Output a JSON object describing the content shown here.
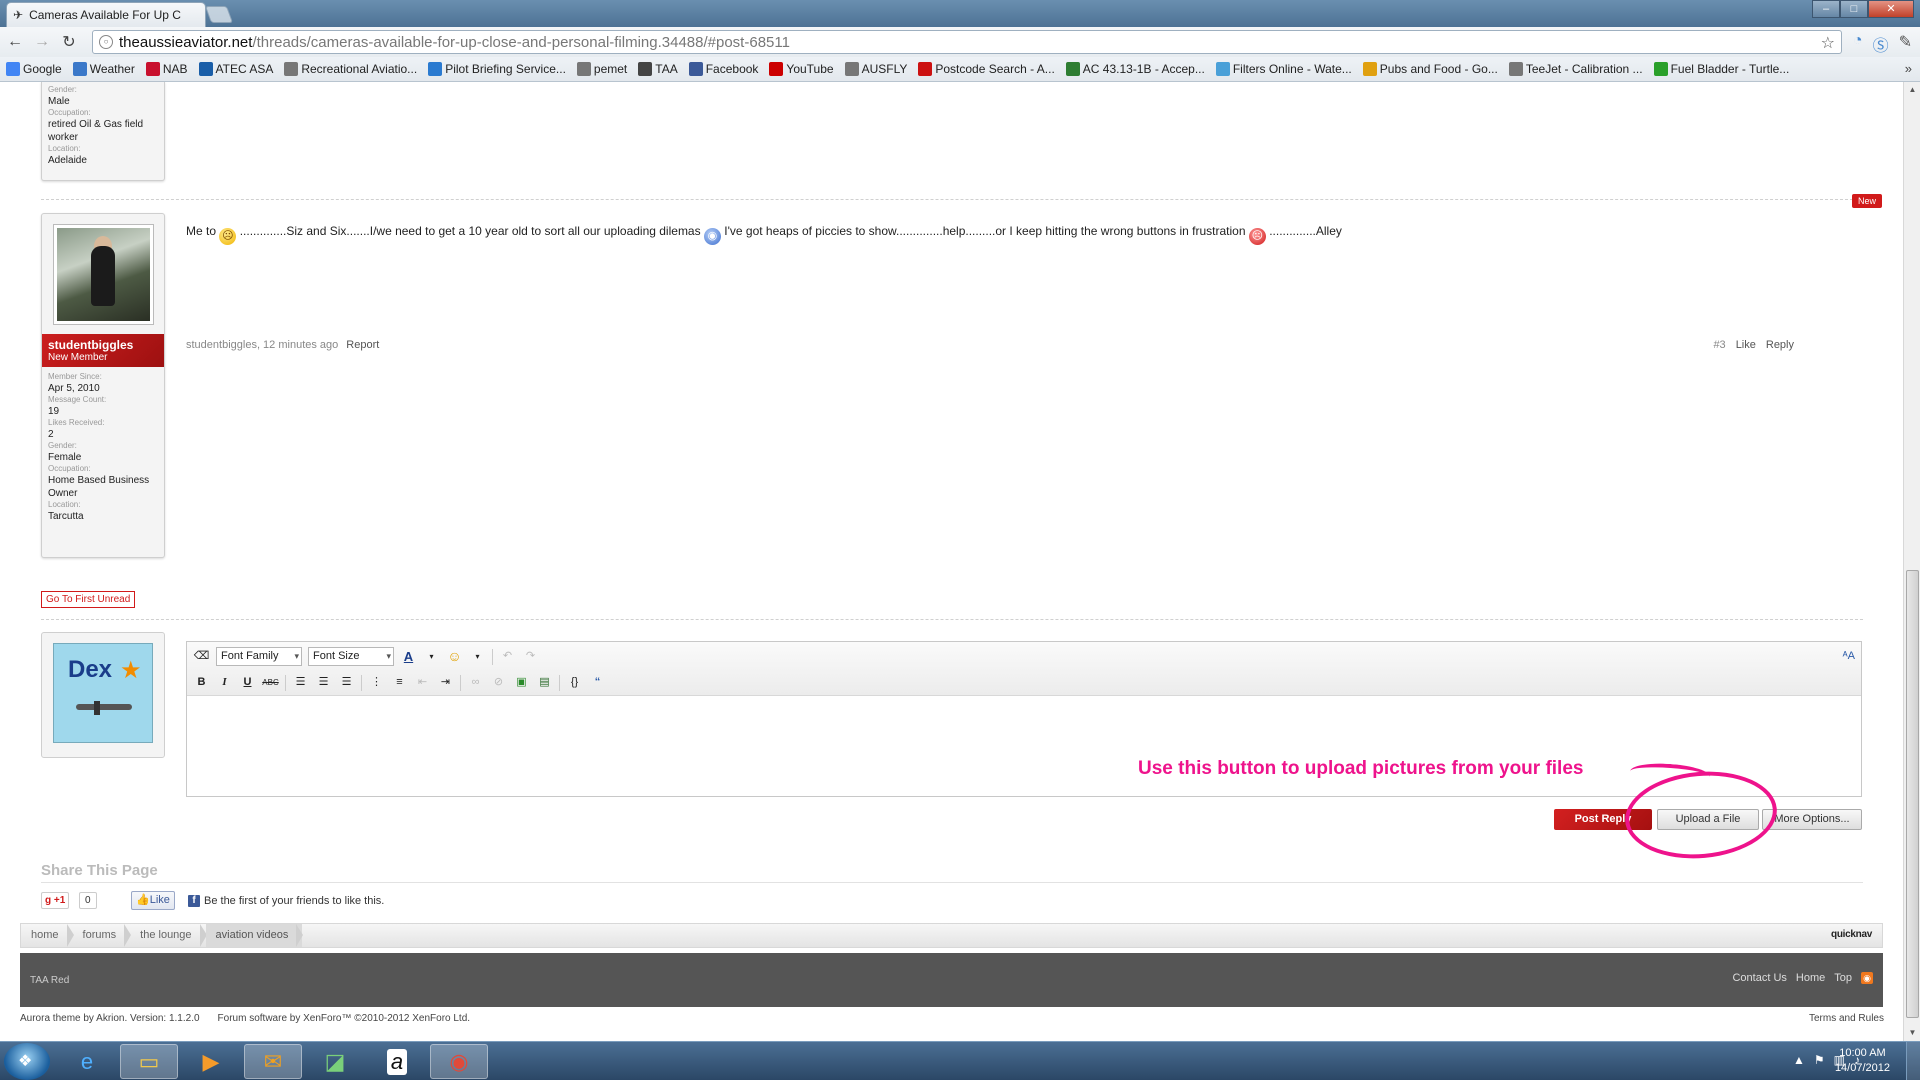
{
  "browser": {
    "tab_title": "Cameras Available For Up C",
    "url_domain": "theaussieaviator.net",
    "url_path": "/threads/cameras-available-for-up-close-and-personal-filming.34488/#post-68511",
    "bookmarks": [
      {
        "label": "Google",
        "icon": "google-icon",
        "color": "#4285f4"
      },
      {
        "label": "Weather",
        "icon": "weather-icon",
        "color": "#3a78c9"
      },
      {
        "label": "NAB",
        "icon": "nab-icon",
        "color": "#c8102e"
      },
      {
        "label": "ATEC ASA",
        "icon": "atec-icon",
        "color": "#1a5ea8"
      },
      {
        "label": "Recreational Aviatio...",
        "icon": "globe-icon",
        "color": "#777777"
      },
      {
        "label": "Pilot Briefing Service...",
        "icon": "briefing-icon",
        "color": "#2a7ad0"
      },
      {
        "label": "pemet",
        "icon": "globe-icon",
        "color": "#777777"
      },
      {
        "label": "TAA",
        "icon": "taa-icon",
        "color": "#444444"
      },
      {
        "label": "Facebook",
        "icon": "facebook-icon",
        "color": "#3b5998"
      },
      {
        "label": "YouTube",
        "icon": "youtube-icon",
        "color": "#cc0000"
      },
      {
        "label": "AUSFLY",
        "icon": "globe-icon",
        "color": "#777777"
      },
      {
        "label": "Postcode Search - A...",
        "icon": "postcode-icon",
        "color": "#cc1111"
      },
      {
        "label": "AC 43.13-1B - Accep...",
        "icon": "ac-icon",
        "color": "#2e7d32"
      },
      {
        "label": "Filters Online - Wate...",
        "icon": "filters-icon",
        "color": "#4aa0d8"
      },
      {
        "label": "Pubs and Food - Go...",
        "icon": "pubs-icon",
        "color": "#e0a010"
      },
      {
        "label": "TeeJet - Calibration ...",
        "icon": "globe-icon",
        "color": "#777777"
      },
      {
        "label": "Fuel Bladder - Turtle...",
        "icon": "fuel-icon",
        "color": "#2aa02a"
      }
    ]
  },
  "prev_user": {
    "k_gender": "Gender:",
    "v_gender": "Male",
    "k_occ": "Occupation:",
    "v_occ": "retired Oil & Gas field worker",
    "k_loc": "Location:",
    "v_loc": "Adelaide"
  },
  "post": {
    "new_badge": "New",
    "author": "studentbiggles",
    "user_title": "New Member",
    "k_since": "Member Since:",
    "v_since": "Apr 5, 2010",
    "k_msgs": "Message Count:",
    "v_msgs": "19",
    "k_likes": "Likes Received:",
    "v_likes": "2",
    "k_gender": "Gender:",
    "v_gender": "Female",
    "k_occ": "Occupation:",
    "v_occ": "Home Based Business Owner",
    "k_loc": "Location:",
    "v_loc": "Tarcutta",
    "body_1": "Me to ",
    "body_2": " ..............Siz and Six.......I/we need to get a 10 year old to sort all our uploading dilemas ",
    "body_3": " I've got heaps of piccies to show..............help.........or I keep hitting the wrong buttons in frustration ",
    "body_4": " ..............Alley",
    "meta": "studentbiggles, 12 minutes ago",
    "report": "Report",
    "permalink": "#3",
    "like": "Like",
    "reply": "Reply"
  },
  "go_first_unread": "Go To First Unread",
  "editor": {
    "font_family": "Font Family",
    "font_size": "Font Size",
    "annotation": "Use this button to upload pictures from your files",
    "post_reply": "Post Reply",
    "upload": "Upload a File",
    "more": "More Options..."
  },
  "share": {
    "title": "Share This Page",
    "gplus": "+1",
    "gcount": "0",
    "fb_like": "Like",
    "fb_text": "Be the first of your friends to like this."
  },
  "breadcrumbs": [
    "home",
    "forums",
    "the lounge",
    "aviation videos"
  ],
  "quicknav": "quicknav",
  "footer": {
    "style": "TAA Red",
    "links": [
      "Contact Us",
      "Home",
      "Top"
    ],
    "theme": "Aurora theme by Akrion. Version: 1.1.2.0",
    "software": "Forum software by XenForo™ ©2010-2012 XenForo Ltd.",
    "terms": "Terms and Rules"
  },
  "taskbar": {
    "time": "10:00 AM",
    "date": "14/07/2012"
  }
}
